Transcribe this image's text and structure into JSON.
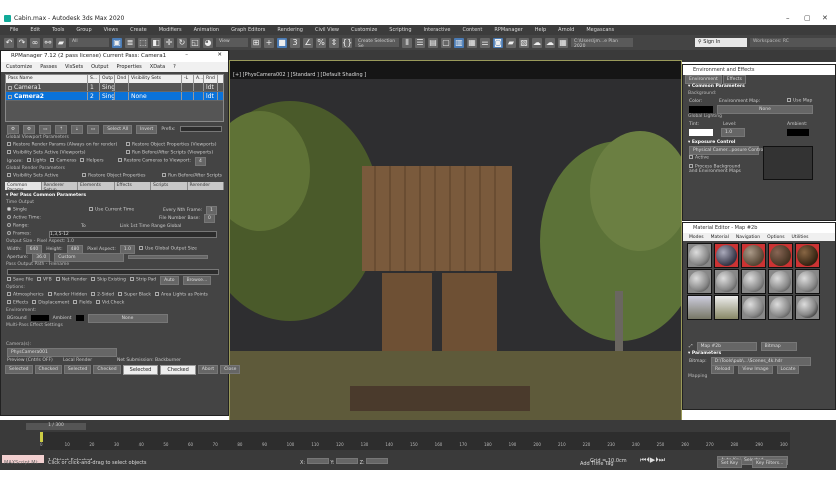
{
  "window": {
    "title": "Cabin.max - Autodesk 3ds Max 2020"
  },
  "menu": [
    "File",
    "Edit",
    "Tools",
    "Group",
    "Views",
    "Create",
    "Modifiers",
    "Animation",
    "Graph Editors",
    "Rendering",
    "Civil View",
    "Customize",
    "Scripting",
    "Interactive",
    "Content",
    "RPManager",
    "Help",
    "Arnold",
    "Megascans"
  ],
  "toolbar": {
    "filter": "All",
    "view": "View",
    "selection_set": "Create Selection Se",
    "project_path": "C:\\Users\\jm...e Plan 2020",
    "sign_in": "Sign In",
    "workspace_label": "Workspaces:",
    "workspace": "RC"
  },
  "rpm": {
    "title": "RPManager 7.12 (2 pass license)   Current Pass: Camera1",
    "menu": [
      "Customize",
      "Passes",
      "VisSets",
      "Output",
      "Properties",
      "XData",
      "?"
    ],
    "columns": [
      "Pass Name",
      "S...",
      "Outp",
      "Dnd",
      "Visibility Sets",
      "-L",
      "A...",
      "Rnd"
    ],
    "passes": [
      {
        "name": "Camera1",
        "s": "1",
        "outp": "Sing",
        "dnd": "",
        "vis": "",
        "rnd": "ldt",
        "selected": false
      },
      {
        "name": "Camera2",
        "s": "2",
        "outp": "Sing",
        "dnd": "",
        "vis": "None",
        "rnd": "ldt",
        "selected": true
      }
    ],
    "select_all": "Select All",
    "invert": "Invert",
    "prefix_label": "Prefix:",
    "gvp": {
      "title": "Global Viewport Parameters",
      "restore_render": "Restore Render Params (Always on for render)",
      "restore_obj": "Restore Object Properties (Viewports)",
      "vis_sets": "Visibility Sets Active (Viewports)",
      "run_scripts": "Run Before/After Scripts (Viewports)",
      "ignore": "Ignore:",
      "lights": "Lights",
      "cameras": "Cameras",
      "helpers": "Helpers",
      "restore_cams": "Restore Cameras to Viewport:",
      "restore_cams_val": "4"
    },
    "grp": {
      "title": "Global Render Parameters",
      "vis_sets": "Visibility Sets Active",
      "restore_obj": "Restore Object Properties",
      "run_scripts": "Run Before/After Scripts"
    },
    "tabs": [
      "Common Params",
      "Renderer Setup",
      "Elements",
      "Effects",
      "Scripts",
      "Rerender"
    ],
    "ppc": {
      "title": "Per Pass Common Parameters",
      "time_output": "Time Output",
      "single": "Single",
      "use_current": "Use Current Time",
      "every_nth": "Every Nth Frame:",
      "every_nth_val": "1",
      "active_time": "Active Time:",
      "file_number": "File Number Base:",
      "file_number_val": "0",
      "range": "Range:",
      "to": "To",
      "link": "Link 1st Time Range Global",
      "frames": "Frames:",
      "frames_val": "1,3,5-12",
      "output_size": "Output Size - Pixel Aspect: 1.0",
      "width": "Width:",
      "width_val": "640",
      "height": "Height:",
      "height_val": "480",
      "pixel_aspect": "Pixel Aspect:",
      "pixel_aspect_val": "1.0",
      "use_global": "Use Global Output Size",
      "aperture": "Aperture:",
      "aperture_val": "36.0",
      "custom": "Custom",
      "path_title": "Pass Output Path - Filename",
      "save_file": "Save File",
      "vfb": "VFB",
      "net_render": "Net Render",
      "skip_existing": "Skip Existing",
      "strip_pad": "Strip Pad",
      "auto": "Auto",
      "browse": "Browse...",
      "options": "Options:",
      "atmospherics": "Atmospherics",
      "render_hidden": "Render Hidden",
      "two_sided": "2-Sided",
      "super_black": "Super Black",
      "area_lights": "Area Lights as Points",
      "effects": "Effects",
      "displacement": "Displacement",
      "fields": "Fields",
      "vid_check": "Vid.Check",
      "environment": "Environment:",
      "bground": "BGround",
      "ambient": "Ambient",
      "env_none": "None",
      "multi_pass": "Multi-Pass Effect Settings",
      "cameras": "Camera(s):",
      "camera_val": "PhysCamera001"
    },
    "footer": {
      "preview": "Preview (Cntrls OFF)",
      "local": "Local Render",
      "net": "Net Submission: Backburner",
      "selected": "Selected",
      "checked": "Checked",
      "abort": "Abort",
      "close": "Close"
    }
  },
  "viewport": {
    "label": "[+] [PhysCamera002 ] [Standard ] [Default Shading ]"
  },
  "env": {
    "title": "Environment and Effects",
    "tabs": [
      "Environment",
      "Effects"
    ],
    "common": "Common Parameters",
    "background": "Background:",
    "color": "Color:",
    "env_map": "Environment Map:",
    "use_map": "Use Map",
    "none": "None",
    "global_lighting": "Global Lighting",
    "tint": "Tint:",
    "level": "Level:",
    "level_val": "1.0",
    "ambient": "Ambient:",
    "exposure": "Exposure Control",
    "exposure_val": "Physical Camer...posure Control",
    "active": "Active",
    "process_bg": "Process Background and Environment Maps",
    "colors": {
      "bg": "#000000",
      "tint": "#ffffff",
      "ambient": "#000000"
    }
  },
  "mat": {
    "title": "Material Editor - Map #2b",
    "menu": [
      "Modes",
      "Material",
      "Navigation",
      "Options",
      "Utilities"
    ],
    "map_name": "Map #2b",
    "map_type": "Bitmap",
    "params": "Parameters",
    "bitmap_label": "Bitmap:",
    "bitmap_path": "D:\\Tools\\pub\\...\\Scenes_4k.hdr",
    "reload": "Reload",
    "view_image": "View Image",
    "locate": "Locate",
    "mapping": "Mapping"
  },
  "timeline": {
    "frame": "1 / 300",
    "ticks": [
      "0",
      "10",
      "20",
      "30",
      "40",
      "50",
      "60",
      "70",
      "80",
      "90",
      "100",
      "110",
      "120",
      "130",
      "140",
      "150",
      "160",
      "170",
      "180",
      "190",
      "200",
      "210",
      "220",
      "230",
      "240",
      "250",
      "260",
      "270",
      "280",
      "290",
      "300"
    ],
    "status": "1 Object Selected",
    "prompt": "Click or click-and-drag to select objects",
    "script_label": "MAXScript Mi:",
    "x": "X:",
    "y": "Y:",
    "z": "Z:",
    "grid": "Grid = 10.0cm",
    "add_time_tag": "Add Time Tag",
    "auto_key": "Auto Key",
    "selected": "Selected",
    "set_key": "Set Key",
    "key_filters": "Key Filters...",
    "frame_field": "0"
  }
}
